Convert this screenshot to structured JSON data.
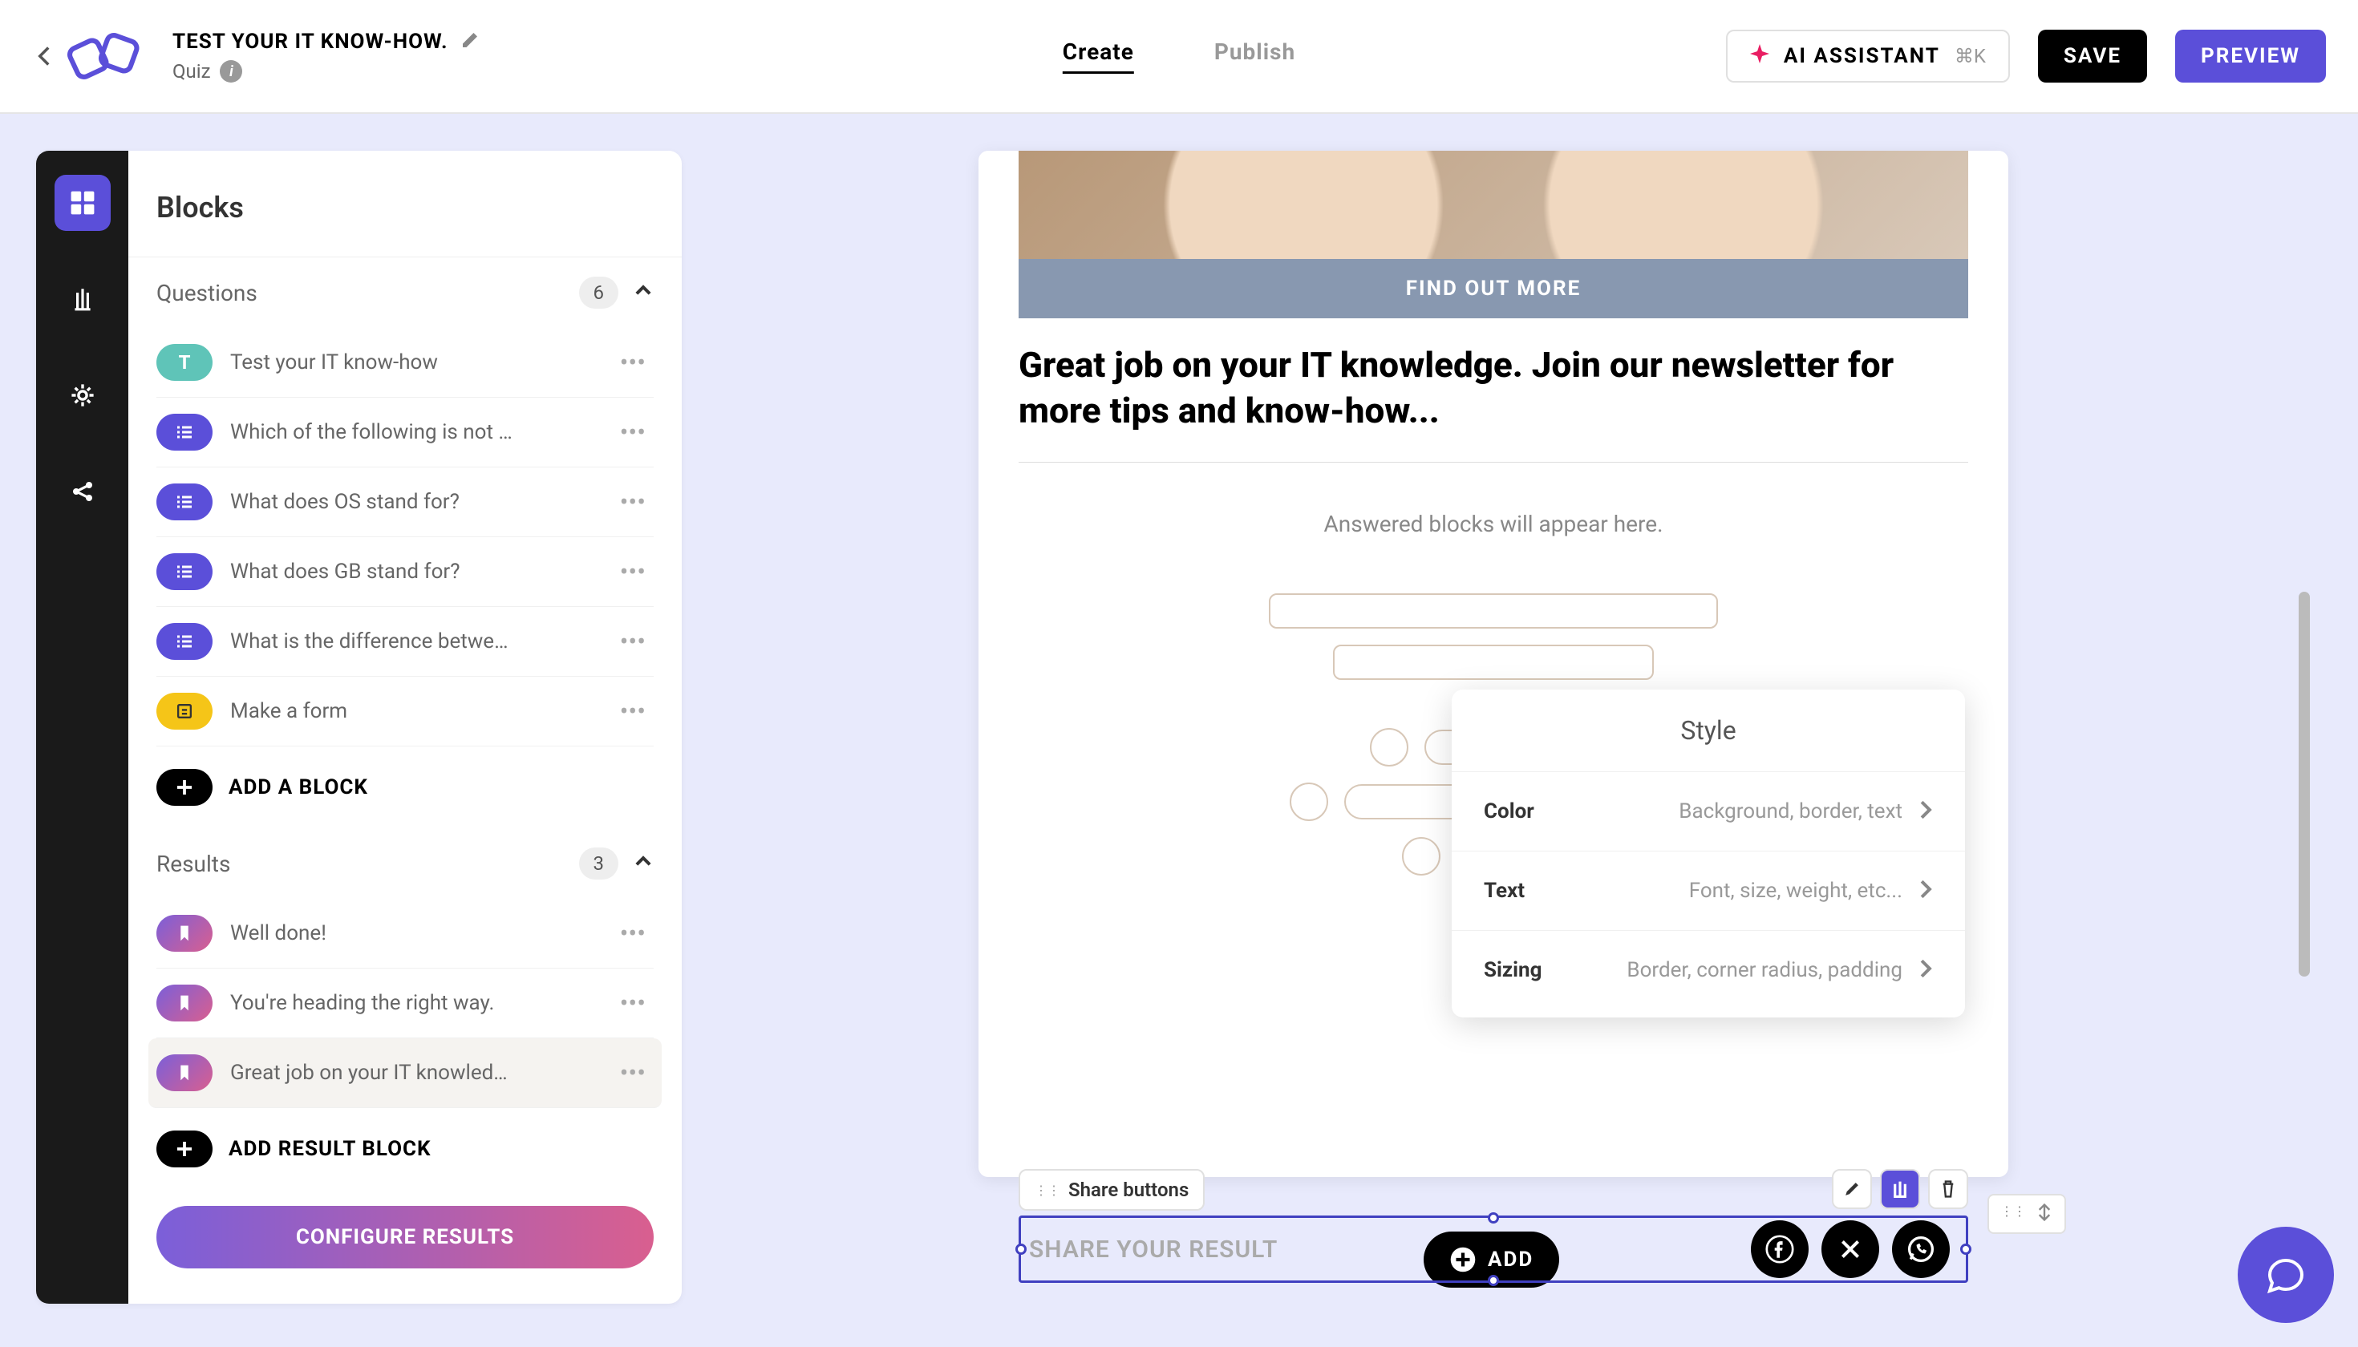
{
  "header": {
    "title": "TEST YOUR IT KNOW-HOW.",
    "subtitle": "Quiz",
    "tabs": {
      "create": "Create",
      "publish": "Publish"
    },
    "ai_label": "AI ASSISTANT",
    "ai_shortcut": "⌘K",
    "save": "SAVE",
    "preview": "PREVIEW"
  },
  "sidebar": {
    "panel_title": "Blocks",
    "questions": {
      "title": "Questions",
      "count": "6",
      "items": [
        {
          "icon_text": "T",
          "icon_class": "teal",
          "label": "Test your IT know-how"
        },
        {
          "icon_class": "purple",
          "label": "Which of the following is not …"
        },
        {
          "icon_class": "purple",
          "label": "What does OS stand for?"
        },
        {
          "icon_class": "purple",
          "label": "What does GB stand for?"
        },
        {
          "icon_class": "purple",
          "label": "What is the difference betwe…"
        },
        {
          "icon_class": "yellow",
          "label": "Make a form"
        }
      ],
      "add": "ADD A BLOCK"
    },
    "results": {
      "title": "Results",
      "count": "3",
      "items": [
        {
          "icon_class": "gradient",
          "label": "Well done!"
        },
        {
          "icon_class": "gradient",
          "label": "You're heading the right way."
        },
        {
          "icon_class": "gradient",
          "label": "Great job on your IT knowled…",
          "selected": true
        }
      ],
      "add": "ADD RESULT BLOCK"
    },
    "configure": "CONFIGURE RESULTS"
  },
  "canvas": {
    "find_more": "FIND OUT MORE",
    "headline": "Great job on your IT knowledge. Join our newsletter for more tips and know-how...",
    "placeholder": "Answered blocks will appear here.",
    "element_label": "Share buttons",
    "share_text": "SHARE YOUR RESULT"
  },
  "style_popup": {
    "title": "Style",
    "rows": [
      {
        "label": "Color",
        "desc": "Background, border, text"
      },
      {
        "label": "Text",
        "desc": "Font, size, weight, etc..."
      },
      {
        "label": "Sizing",
        "desc": "Border, corner radius, padding"
      }
    ]
  },
  "bottom": {
    "add": "ADD"
  }
}
